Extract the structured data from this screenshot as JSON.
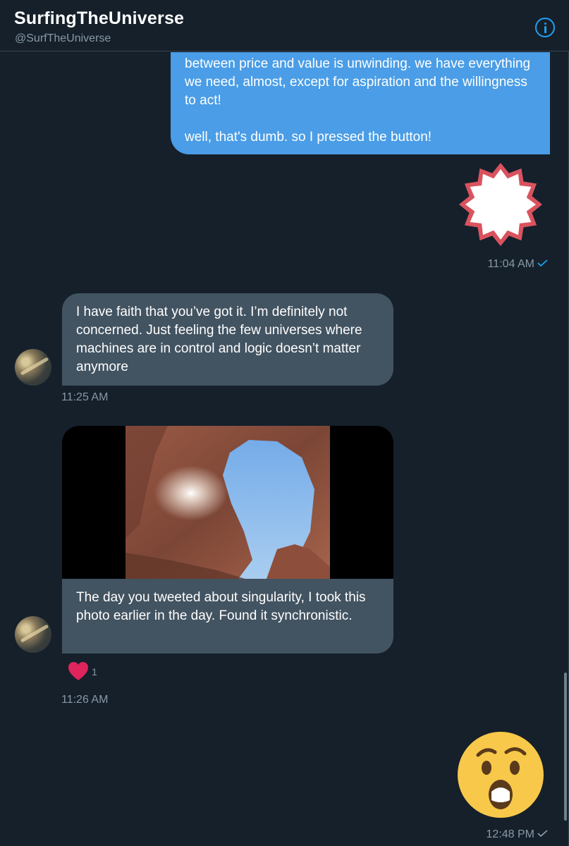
{
  "header": {
    "title": "SurfingTheUniverse",
    "handle": "@SurfTheUniverse",
    "info_icon": "info-icon"
  },
  "messages": {
    "outgoing_text": {
      "line_block_1": "between price and value is unwinding. we have everything we need, almost, except for aspiration and the willingness to act!",
      "line_block_2": "well, that's dumb. so I pressed the button!"
    },
    "sticker_star": {
      "icon": "starburst-sticker",
      "colors": {
        "fill": "#ffffff",
        "outline": "#d9535f"
      }
    },
    "timestamp_1": "11:04 AM",
    "incoming_1": {
      "text": "I have faith that you’ve got it.  I’m definitely not concerned.  Just feeling the few universes where machines are in control and logic doesn’t matter anymore",
      "timestamp": "11:25 AM"
    },
    "incoming_2": {
      "photo": "arch-photo",
      "caption": "The day you tweeted about singularity, I took this photo earlier in the day. Found it synchronistic.",
      "reaction_count": "1",
      "timestamp": "11:26 AM"
    },
    "sticker_wow": {
      "icon": "surprised-face-sticker"
    },
    "timestamp_last": "12:48 PM"
  },
  "colors": {
    "background": "#15202b",
    "outgoing_bubble": "#4a9de6",
    "incoming_bubble": "#425361",
    "muted_text": "#8899a6",
    "accent": "#1da1f2",
    "heart": "#e0245e"
  }
}
